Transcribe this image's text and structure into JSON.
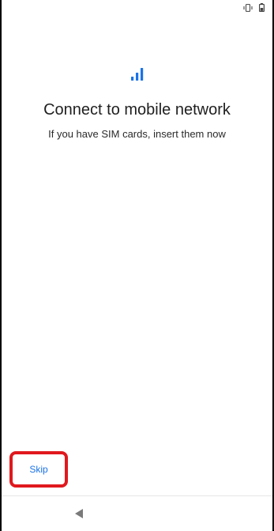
{
  "status_bar": {
    "icons": [
      "vibrate-icon",
      "battery-icon"
    ]
  },
  "main": {
    "icon": "signal-bars-icon",
    "accent_color": "#1a73e8",
    "title": "Connect to mobile network",
    "subtitle": "If you have SIM cards, insert them now"
  },
  "footer": {
    "skip_label": "Skip",
    "highlight_color": "#e0191e"
  },
  "navigation": {
    "back_icon": "back-triangle-icon"
  }
}
